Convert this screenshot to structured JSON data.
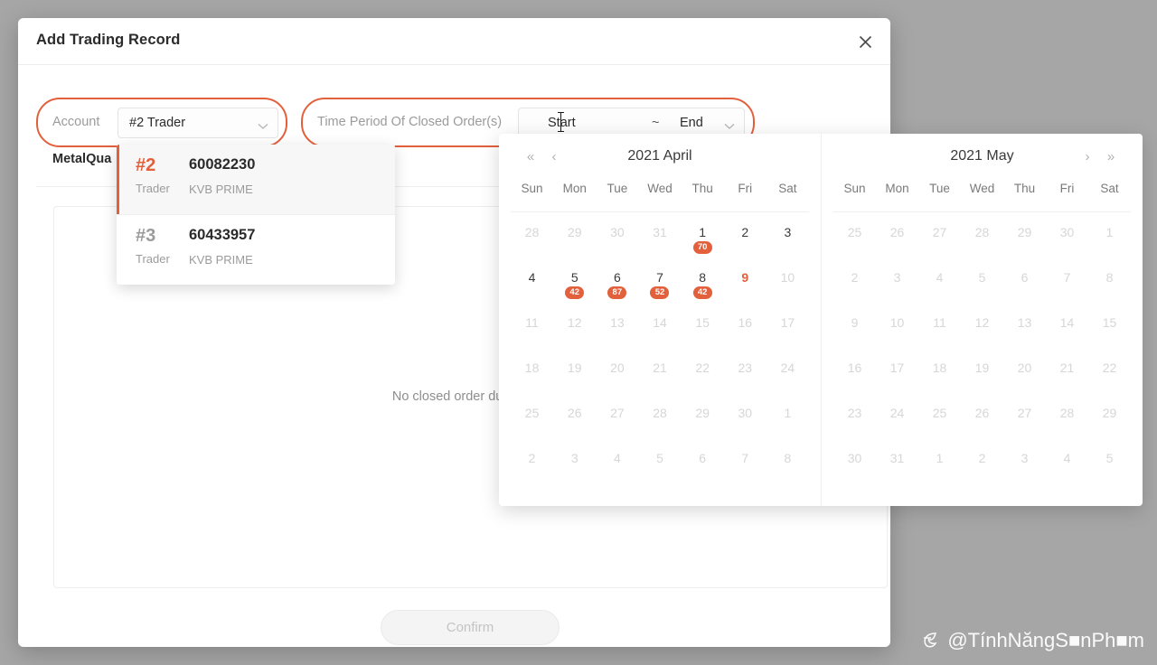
{
  "modal": {
    "title": "Add Trading Record",
    "close_icon": "close-icon",
    "confirm_label": "Confirm",
    "empty_text": "No closed order during this",
    "sub_label": "MetalQua"
  },
  "filters": {
    "account": {
      "label": "Account",
      "value": "#2 Trader",
      "chevron_icon": "chevron-down-icon",
      "ring_color": "#e2603c"
    },
    "period": {
      "label": "Time Period Of Closed Order(s)",
      "start_placeholder": "Start",
      "separator": "~",
      "end_placeholder": "End",
      "chevron_icon": "chevron-down-icon",
      "ring_color": "#e2603c"
    }
  },
  "account_dropdown": {
    "items": [
      {
        "rank": "#2",
        "role": "Trader",
        "number": "60082230",
        "broker": "KVB PRIME",
        "selected": true
      },
      {
        "rank": "#3",
        "role": "Trader",
        "number": "60433957",
        "broker": "KVB PRIME",
        "selected": false
      }
    ]
  },
  "calendar": {
    "accent": "#e2603c",
    "dow": [
      "Sun",
      "Mon",
      "Tue",
      "Wed",
      "Thu",
      "Fri",
      "Sat"
    ],
    "nav": {
      "prev_year": "«",
      "prev_month": "‹",
      "next_month": "›",
      "next_year": "»"
    },
    "panels": [
      {
        "title": "2021 April",
        "show_prev_nav": true,
        "show_next_nav": false,
        "cells": [
          {
            "d": "28",
            "muted": true
          },
          {
            "d": "29",
            "muted": true
          },
          {
            "d": "30",
            "muted": true
          },
          {
            "d": "31",
            "muted": true
          },
          {
            "d": "1",
            "muted": false,
            "badge": "70"
          },
          {
            "d": "2",
            "muted": false
          },
          {
            "d": "3",
            "muted": false
          },
          {
            "d": "4",
            "muted": false
          },
          {
            "d": "5",
            "muted": false,
            "badge": "42"
          },
          {
            "d": "6",
            "muted": false,
            "badge": "87"
          },
          {
            "d": "7",
            "muted": false,
            "badge": "52"
          },
          {
            "d": "8",
            "muted": false,
            "badge": "42"
          },
          {
            "d": "9",
            "muted": false,
            "today": true
          },
          {
            "d": "10",
            "muted": true
          },
          {
            "d": "11",
            "muted": true
          },
          {
            "d": "12",
            "muted": true
          },
          {
            "d": "13",
            "muted": true
          },
          {
            "d": "14",
            "muted": true
          },
          {
            "d": "15",
            "muted": true
          },
          {
            "d": "16",
            "muted": true
          },
          {
            "d": "17",
            "muted": true
          },
          {
            "d": "18",
            "muted": true
          },
          {
            "d": "19",
            "muted": true
          },
          {
            "d": "20",
            "muted": true
          },
          {
            "d": "21",
            "muted": true
          },
          {
            "d": "22",
            "muted": true
          },
          {
            "d": "23",
            "muted": true
          },
          {
            "d": "24",
            "muted": true
          },
          {
            "d": "25",
            "muted": true
          },
          {
            "d": "26",
            "muted": true
          },
          {
            "d": "27",
            "muted": true
          },
          {
            "d": "28",
            "muted": true
          },
          {
            "d": "29",
            "muted": true
          },
          {
            "d": "30",
            "muted": true
          },
          {
            "d": "1",
            "muted": true
          },
          {
            "d": "2",
            "muted": true
          },
          {
            "d": "3",
            "muted": true
          },
          {
            "d": "4",
            "muted": true
          },
          {
            "d": "5",
            "muted": true
          },
          {
            "d": "6",
            "muted": true
          },
          {
            "d": "7",
            "muted": true
          },
          {
            "d": "8",
            "muted": true
          }
        ]
      },
      {
        "title": "2021 May",
        "show_prev_nav": false,
        "show_next_nav": true,
        "cells": [
          {
            "d": "25",
            "muted": true
          },
          {
            "d": "26",
            "muted": true
          },
          {
            "d": "27",
            "muted": true
          },
          {
            "d": "28",
            "muted": true
          },
          {
            "d": "29",
            "muted": true
          },
          {
            "d": "30",
            "muted": true
          },
          {
            "d": "1",
            "muted": true
          },
          {
            "d": "2",
            "muted": true
          },
          {
            "d": "3",
            "muted": true
          },
          {
            "d": "4",
            "muted": true
          },
          {
            "d": "5",
            "muted": true
          },
          {
            "d": "6",
            "muted": true
          },
          {
            "d": "7",
            "muted": true
          },
          {
            "d": "8",
            "muted": true
          },
          {
            "d": "9",
            "muted": true
          },
          {
            "d": "10",
            "muted": true
          },
          {
            "d": "11",
            "muted": true
          },
          {
            "d": "12",
            "muted": true
          },
          {
            "d": "13",
            "muted": true
          },
          {
            "d": "14",
            "muted": true
          },
          {
            "d": "15",
            "muted": true
          },
          {
            "d": "16",
            "muted": true
          },
          {
            "d": "17",
            "muted": true
          },
          {
            "d": "18",
            "muted": true
          },
          {
            "d": "19",
            "muted": true
          },
          {
            "d": "20",
            "muted": true
          },
          {
            "d": "21",
            "muted": true
          },
          {
            "d": "22",
            "muted": true
          },
          {
            "d": "23",
            "muted": true
          },
          {
            "d": "24",
            "muted": true
          },
          {
            "d": "25",
            "muted": true
          },
          {
            "d": "26",
            "muted": true
          },
          {
            "d": "27",
            "muted": true
          },
          {
            "d": "28",
            "muted": true
          },
          {
            "d": "29",
            "muted": true
          },
          {
            "d": "30",
            "muted": true
          },
          {
            "d": "31",
            "muted": true
          },
          {
            "d": "1",
            "muted": true
          },
          {
            "d": "2",
            "muted": true
          },
          {
            "d": "3",
            "muted": true
          },
          {
            "d": "4",
            "muted": true
          },
          {
            "d": "5",
            "muted": true
          }
        ]
      }
    ]
  },
  "watermark": {
    "logo_icon": "leaf-logo-icon",
    "text": "@TínhNăngS■nPh■m"
  }
}
